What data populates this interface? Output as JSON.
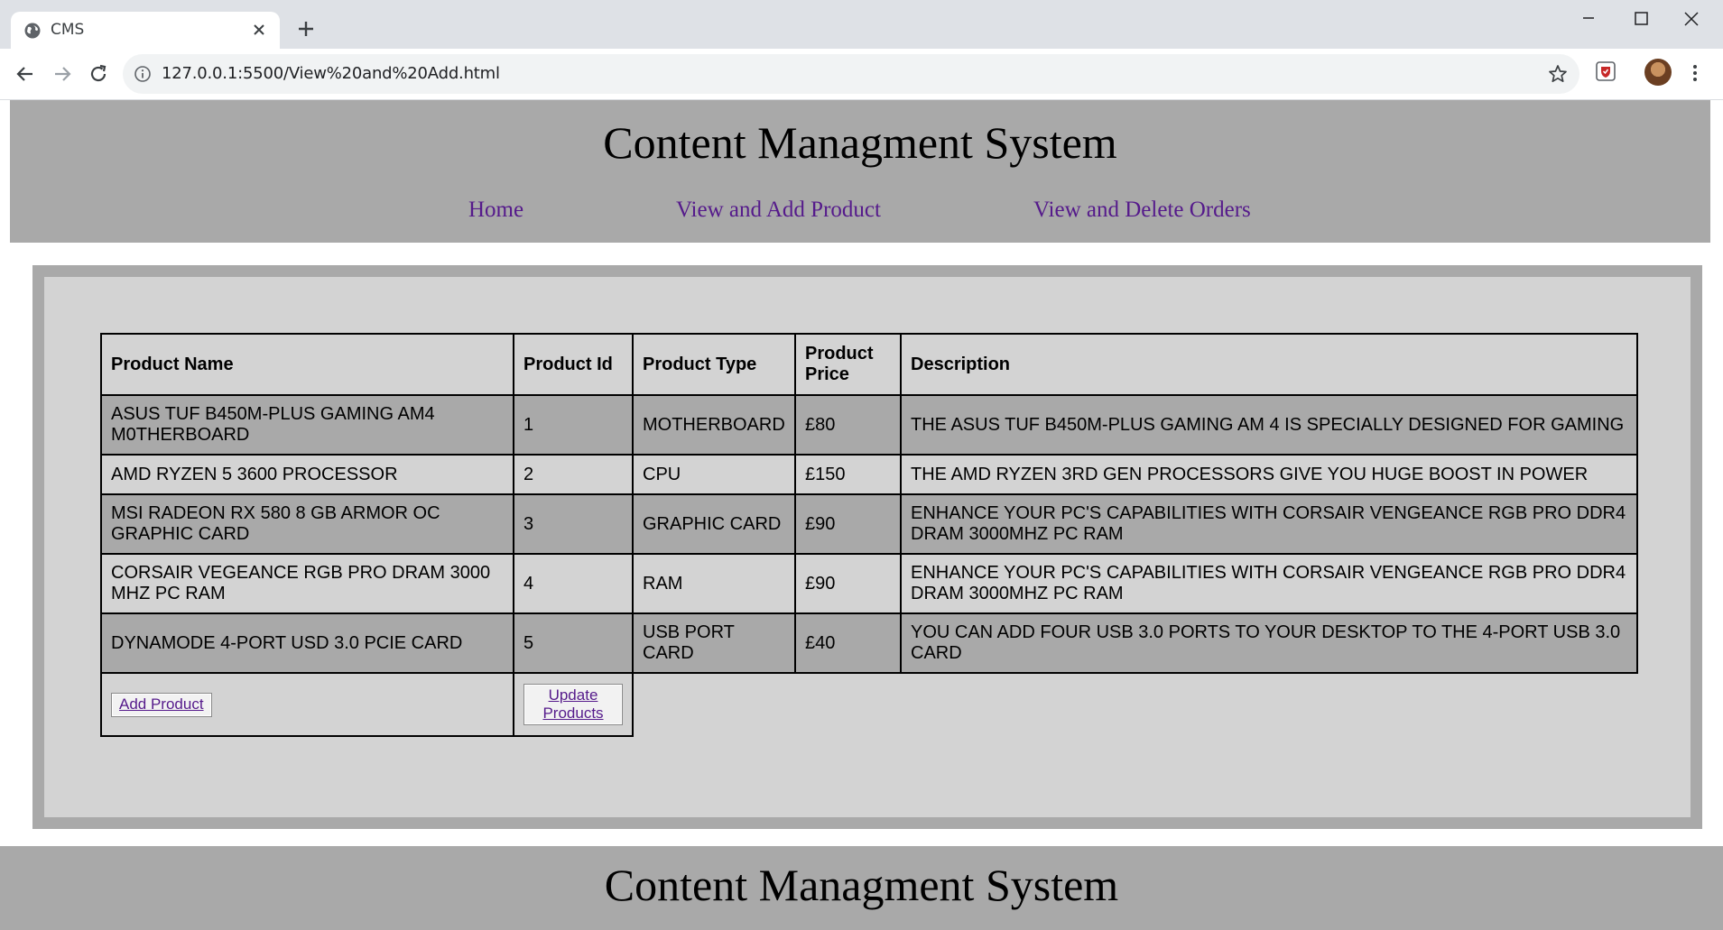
{
  "browser": {
    "tab_title": "CMS",
    "url": "127.0.0.1:5500/View%20and%20Add.html"
  },
  "site": {
    "title": "Content Managment System",
    "nav": [
      "Home",
      "View and Add Product",
      "View and Delete Orders"
    ],
    "footer_title": "Content Managment System"
  },
  "table": {
    "headers": [
      "Product Name",
      "Product Id",
      "Product Type",
      "Product Price",
      "Description"
    ],
    "rows": [
      [
        "ASUS TUF B450M-PLUS GAMING AM4 M0THERBOARD",
        "1",
        "MOTHERBOARD",
        "£80",
        "THE ASUS TUF B450M-PLUS GAMING AM 4 IS SPECIALLY DESIGNED FOR GAMING"
      ],
      [
        "AMD RYZEN 5 3600 PROCESSOR",
        "2",
        "CPU",
        "£150",
        "THE AMD RYZEN 3RD GEN PROCESSORS GIVE YOU HUGE BOOST IN POWER"
      ],
      [
        "MSI RADEON RX 580 8 GB ARMOR OC GRAPHIC CARD",
        "3",
        "GRAPHIC CARD",
        "£90",
        "ENHANCE YOUR PC'S CAPABILITIES WITH CORSAIR VENGEANCE RGB PRO DDR4 DRAM 3000MHZ PC RAM"
      ],
      [
        "CORSAIR VEGEANCE RGB PRO DRAM 3000 MHZ PC RAM",
        "4",
        "RAM",
        "£90",
        "ENHANCE YOUR PC'S CAPABILITIES WITH CORSAIR VENGEANCE RGB PRO DDR4 DRAM 3000MHZ PC RAM"
      ],
      [
        "DYNAMODE 4-PORT USD 3.0 PCIE CARD",
        "5",
        "USB PORT CARD",
        "£40",
        "YOU CAN ADD FOUR USB 3.0 PORTS TO YOUR DESKTOP TO THE 4-PORT USB 3.0 CARD"
      ]
    ]
  },
  "actions": {
    "add_label": "Add Product",
    "update_label": "Update Products"
  },
  "colors": {
    "header_bg": "#a9a9a9",
    "panel_bg": "#d3d3d3",
    "link": "#551a8b"
  }
}
